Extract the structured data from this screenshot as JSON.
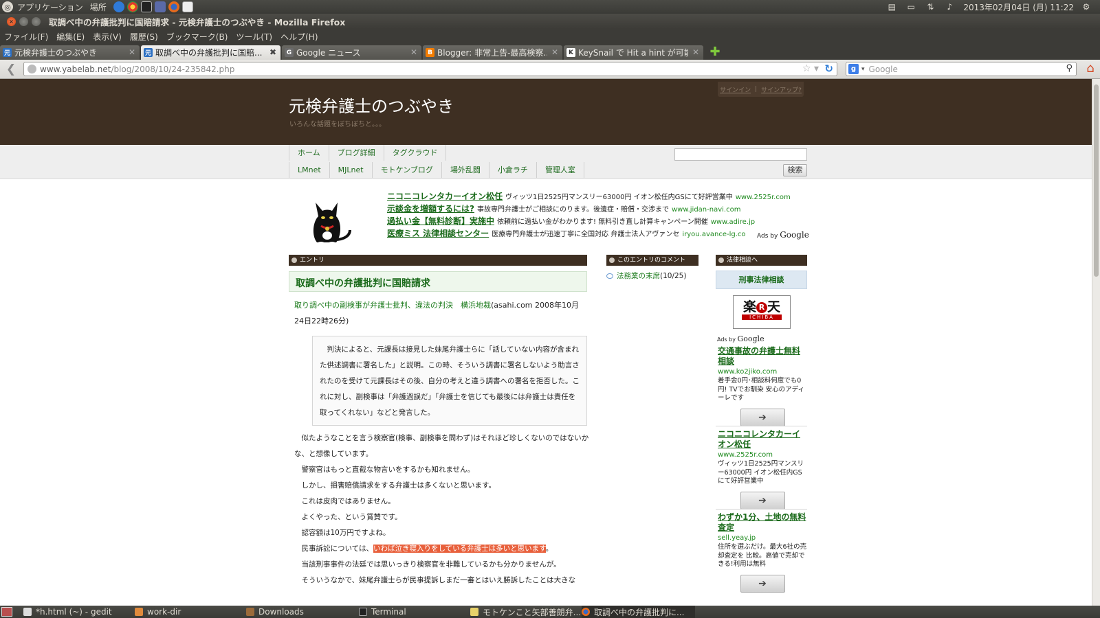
{
  "panel": {
    "apps_menu": "アプリケーション",
    "places_menu": "場所",
    "clock": "2013年02月04日 (月) 11:22"
  },
  "window": {
    "title": "取調べ中の弁護批判に国賠請求 - 元検弁護士のつぶやき - Mozilla Firefox"
  },
  "menubar": [
    "ファイル(F)",
    "編集(E)",
    "表示(V)",
    "履歴(S)",
    "ブックマーク(B)",
    "ツール(T)",
    "ヘルプ(H)"
  ],
  "tabs": [
    {
      "label": "元検弁護士のつぶやき",
      "active": false,
      "color": "#2b6fc2",
      "glyph": "元"
    },
    {
      "label": "取調べ中の弁護批判に国賠...",
      "active": true,
      "color": "#2b6fc2",
      "glyph": "元"
    },
    {
      "label": "Google ニュース",
      "active": false,
      "color": "#6b6b6b",
      "glyph": "G"
    },
    {
      "label": "Blogger: 非常上告-最高検察...",
      "active": false,
      "color": "#f57d00",
      "glyph": "B"
    },
    {
      "label": "KeySnail で Hit a hint が可能...",
      "active": false,
      "color": "#ffffff",
      "glyph": "K"
    }
  ],
  "navbar": {
    "url_host": "www.yabelab.net",
    "url_path": "/blog/2008/10/24-235842.php",
    "search_placeholder": "Google"
  },
  "blog": {
    "title": "元検弁護士のつぶやき",
    "subtitle": "いろんな話題をぼちぼちと。。。",
    "signin": "サインイン",
    "signup": "サインアップ?",
    "sep": "|",
    "nav_row1": [
      "ホーム",
      "ブログ詳細",
      "タグクラウド"
    ],
    "nav_row2": [
      "LMnet",
      "MJLnet",
      "モトケンブログ",
      "場外乱闘",
      "小倉ラチ",
      "管理人室"
    ],
    "search_button": "検索"
  },
  "top_ads": [
    {
      "title": "ニコニコレンタカーイオン松任",
      "desc": "ヴィッツ1日2525円マンスリー63000円 イオン松任内GSにて好評営業中",
      "url": "www.2525r.com"
    },
    {
      "title": "示談金を増額するには?",
      "desc": "事故専門弁護士がご相談にのります。後遺症・賠償・交渉まで",
      "url": "www.jidan-navi.com"
    },
    {
      "title": "過払い金【無料診断】実施中",
      "desc": "依頼前に過払い金がわかります! 無料引き直し計算キャンペーン開催",
      "url": "www.adire.jp"
    },
    {
      "title": "医療ミス 法律相談センター",
      "desc": "医療専門弁護士が迅速丁寧に全国対応 弁護士法人アヴァンセ",
      "url": "iryou.avance-lg.co"
    }
  ],
  "ads_by": {
    "prefix": "Ads by",
    "brand": "Google"
  },
  "entry": {
    "header": "エントリ",
    "title": "取調べ中の弁護批判に国賠請求",
    "source_link": "取り調べ中の副検事が弁護士批判、違法の判決　横浜地裁",
    "source_meta": "(asahi.com 2008年10月24日22時26分)",
    "quote": "　判決によると、元課長は接見した妹尾弁護士らに「話していない内容が含まれた供述調書に署名した」と説明。この時、そういう調書に署名しないよう助言されたのを受けて元課長はその後、自分の考えと違う調書への署名を拒否した。これに対し、副検事は「弁護過誤だ」「弁護士を信じても最後には弁護士は責任を取ってくれない」などと発言した。",
    "body": [
      "　似たようなことを言う検察官(検事、副検事を問わず)はそれほど珍しくないのではないかな、と想像しています。",
      "　警察官はもっと直截な物言いをするかも知れません。",
      "　しかし、損害賠償請求をする弁護士は多くないと思います。",
      "　これは皮肉ではありません。",
      "　よくやった、という賞賛です。",
      "　認容額は10万円ですよね。"
    ],
    "body_hl_prefix": "　民事訴訟については、",
    "body_hl": "いわば泣き寝入りをしている弁護士は多いと思います",
    "body_hl_suffix": "。",
    "body_after": [
      "　当該刑事事件の法廷では思いっきり検察官を非難しているかも分かりませんが。",
      "　そういうなかで、妹尾弁護士らが民事提訴しまだ一審とはいえ勝訴したことは大きな"
    ]
  },
  "comments": {
    "header": "このエントリのコメント",
    "items": [
      {
        "link": "法務業の末席",
        "date": "(10/25)"
      }
    ]
  },
  "legal": {
    "header": "法律相談へ",
    "box": "刑事法律相談",
    "rakuten_main": "楽天",
    "rakuten_r": "R",
    "rakuten_sub": "ICHIBA",
    "ads": [
      {
        "title": "交通事故の弁護士無料相談",
        "url": "www.ko2jiko.com",
        "desc": "着手金0円･相談料何度でも0円! TVでお馴染 安心のアディーレです",
        "btn": "➔"
      },
      {
        "title": "ニコニコレンタカーイオン松任",
        "url": "www.2525r.com",
        "desc": "ヴィッツ1日2525円マンスリー63000円 イオン松任内GSにて好評営業中",
        "btn": "➔"
      },
      {
        "title": "わずか1分、土地の無料査定",
        "url": "sell.yeay.jp",
        "desc": "住所を選ぶだけ。最大6社の売却査定を 比較。高値で売却できる!利用は無料",
        "btn": "➔"
      }
    ]
  },
  "taskbar": [
    {
      "label": "*h.html (~) - gedit",
      "active": false
    },
    {
      "label": "work-dir",
      "active": false
    },
    {
      "label": "Downloads",
      "active": false
    },
    {
      "label": "Terminal",
      "active": false
    },
    {
      "label": "モトケンこと矢部善朗弁...",
      "active": false
    },
    {
      "label": "取調べ中の弁護批判に...",
      "active": true
    }
  ],
  "colors": {
    "blog_header": "#3e2f22",
    "link_green": "#1a6a1a",
    "highlight": "#e8603c"
  }
}
